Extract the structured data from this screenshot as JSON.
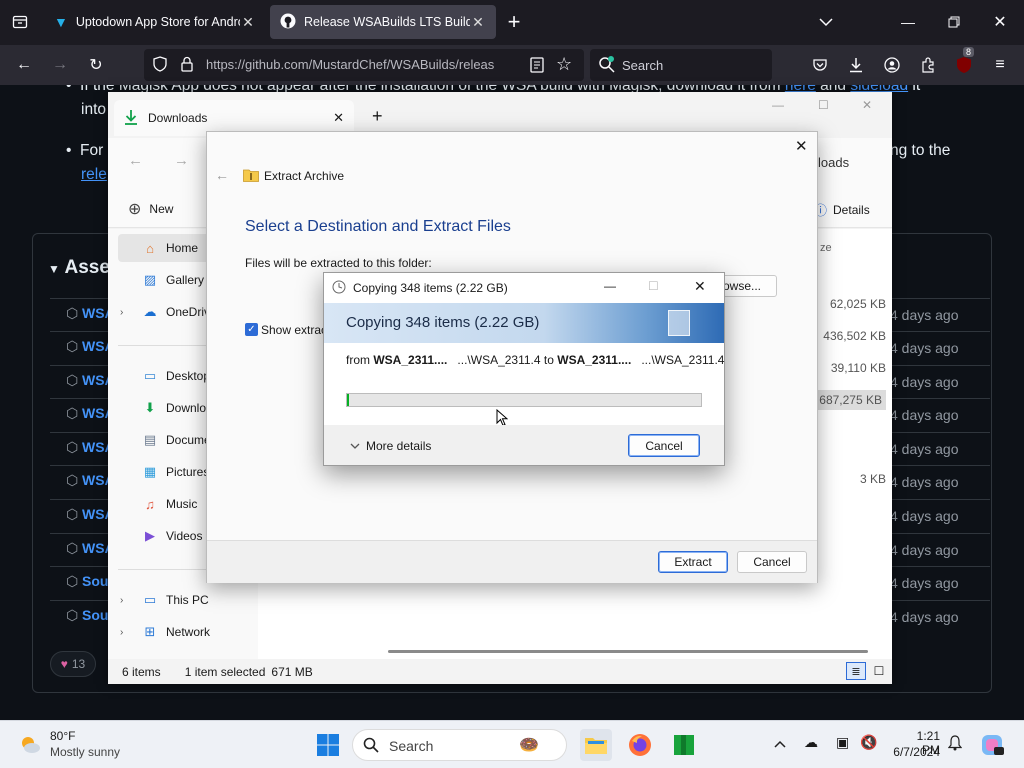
{
  "browser": {
    "tabs": [
      {
        "title": "Uptodown App Store for Andro",
        "icon": "uptodown-icon"
      },
      {
        "title": "Release WSABuilds LTS Build #",
        "icon": "github-icon"
      }
    ],
    "url": "https://github.com/MustardChef/WSABuilds/releas",
    "search_placeholder": "Search",
    "extension_badge": "8"
  },
  "github": {
    "bullet1_text": "If the Magisk App does not appear after the installation of the WSA build with Magisk, download it from",
    "bullet1_link1": "here",
    "bullet1_and": "and",
    "bullet1_link2": "sideload",
    "bullet1_tail": "it",
    "bullet1_cont": "into",
    "bullet2_text": "For",
    "bullet2_right": "ng to the",
    "bullet2_cont": "rele",
    "assets_heading": "Asse",
    "assets": [
      {
        "label": "WSA",
        "date": "4 days ago",
        "icon": "package-icon"
      },
      {
        "label": "WSA",
        "date": "4 days ago",
        "icon": "package-icon"
      },
      {
        "label": "WSA",
        "date": "4 days ago",
        "icon": "package-icon"
      },
      {
        "label": "WSA",
        "date": "4 days ago",
        "icon": "package-icon"
      },
      {
        "label": "WSA",
        "date": "4 days ago",
        "icon": "package-icon"
      },
      {
        "label": "WSA",
        "date": "4 days ago",
        "icon": "package-icon"
      },
      {
        "label": "WSA",
        "date": "4 days ago",
        "icon": "package-icon"
      },
      {
        "label": "WSA",
        "date": "4 days ago",
        "icon": "package-icon"
      },
      {
        "label": "Sour",
        "date": "4 days ago",
        "icon": "file-zip-icon"
      },
      {
        "label": "Sour",
        "date": "4 days ago",
        "icon": "file-zip-icon"
      }
    ],
    "reaction_count": "13"
  },
  "explorer": {
    "tab_title": "Downloads",
    "new_label": "New",
    "details_label": "Details",
    "breadcrumb_tail": "loads",
    "size_header": "ze",
    "sidebar": [
      {
        "label": "Home",
        "icon": "home-icon",
        "selected": true
      },
      {
        "label": "Gallery",
        "icon": "gallery-icon"
      },
      {
        "label": "OneDriv",
        "icon": "onedrive-icon",
        "expandable": true
      },
      {
        "label": "Desktop",
        "icon": "desktop-icon"
      },
      {
        "label": "Downlo",
        "icon": "downloads-icon"
      },
      {
        "label": "Docume",
        "icon": "documents-icon"
      },
      {
        "label": "Pictures",
        "icon": "pictures-icon"
      },
      {
        "label": "Music",
        "icon": "music-icon"
      },
      {
        "label": "Videos",
        "icon": "videos-icon"
      },
      {
        "label": "This PC",
        "icon": "this-pc-icon",
        "expandable": true
      },
      {
        "label": "Network",
        "icon": "network-icon",
        "expandable": true
      }
    ],
    "sizes": [
      "62,025 KB",
      "436,502 KB",
      "39,110 KB",
      "687,275 KB",
      "3 KB"
    ],
    "status_items": "6 items",
    "status_selected": "1 item selected",
    "status_size": "671 MB"
  },
  "extract_dialog": {
    "title": "Extract Archive",
    "heading": "Select a Destination and Extract Files",
    "folder_label": "Files will be extracted to this folder:",
    "browse_label": "owse...",
    "show_label": "Show extract",
    "extract_button": "Extract",
    "cancel_button": "Cancel"
  },
  "copy_dialog": {
    "title": "Copying 348 items (2.22 GB)",
    "header": "Copying 348 items (2.22 GB)",
    "from_label": "from",
    "from_name": "WSA_2311....",
    "from_path": "...\\WSA_2311.4",
    "to_label": "to",
    "to_name": "WSA_2311....",
    "to_path": "...\\WSA_2311.4",
    "progress": 0.005,
    "more_details": "More details",
    "cancel_button": "Cancel"
  },
  "taskbar": {
    "temperature": "80°F",
    "weather": "Mostly sunny",
    "search_label": "Search",
    "time": "1:21 PM",
    "date": "6/7/2024"
  },
  "colors": {
    "firefox_bg": "#1c1b22",
    "link": "#4493f8",
    "progress": "#06b025",
    "extract_heading": "#1a3f8f"
  }
}
